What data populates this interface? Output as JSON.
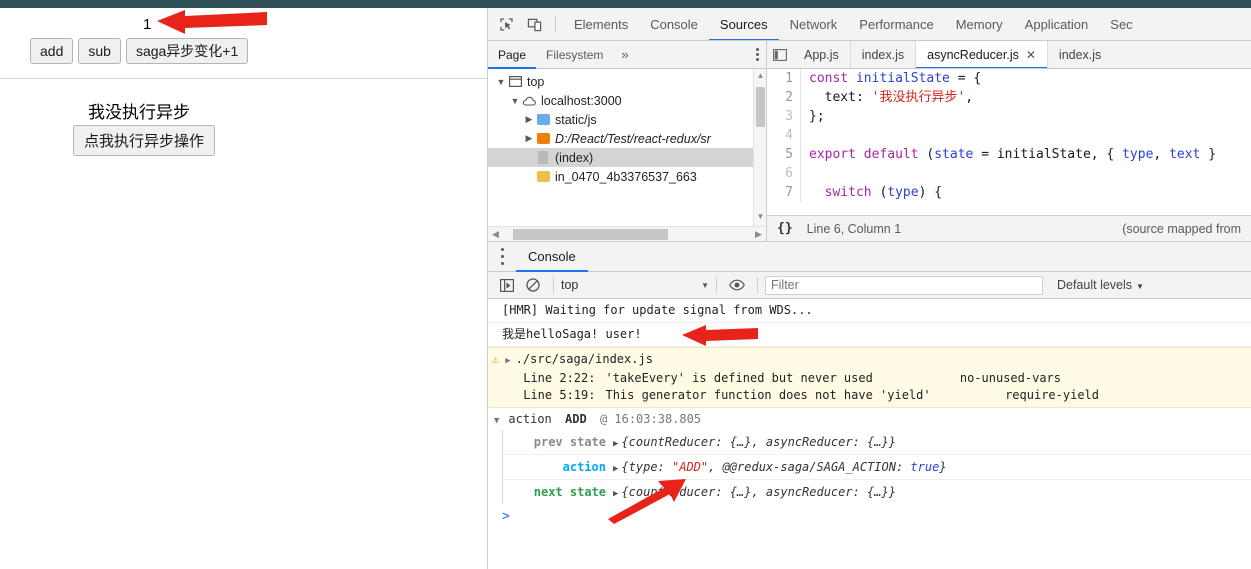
{
  "webpage": {
    "counter_value": "1",
    "buttons": [
      {
        "label": "add",
        "name": "add-button"
      },
      {
        "label": "sub",
        "name": "sub-button"
      },
      {
        "label": "saga异步变化+1",
        "name": "saga-async-button"
      }
    ],
    "async_text": "我没执行异步",
    "async_button": "点我执行异步操作"
  },
  "devtools": {
    "tabs": [
      {
        "label": "Elements",
        "active": false
      },
      {
        "label": "Console",
        "active": false
      },
      {
        "label": "Sources",
        "active": true
      },
      {
        "label": "Network",
        "active": false
      },
      {
        "label": "Performance",
        "active": false
      },
      {
        "label": "Memory",
        "active": false
      },
      {
        "label": "Application",
        "active": false
      },
      {
        "label": "Sec",
        "active": false
      }
    ],
    "inspect_icon": "inspect-element-icon",
    "device_icon": "device-toolbar-icon",
    "navigator": {
      "tabs": [
        {
          "label": "Page",
          "active": true
        },
        {
          "label": "Filesystem",
          "active": false
        }
      ],
      "more_label": "»",
      "tree": [
        {
          "label": "top",
          "indent": 0,
          "twisty": "▼",
          "icon": "frame-icon",
          "selected": false,
          "italic": false
        },
        {
          "label": "localhost:3000",
          "indent": 1,
          "twisty": "▼",
          "icon": "cloud-icon",
          "selected": false,
          "italic": false
        },
        {
          "label": "static/js",
          "indent": 2,
          "twisty": "▶",
          "icon": "folder-blue",
          "selected": false,
          "italic": false
        },
        {
          "label": "D:/React/Test/react-redux/sr",
          "indent": 2,
          "twisty": "▶",
          "icon": "folder-orange",
          "selected": false,
          "italic": true
        },
        {
          "label": "(index)",
          "indent": 3,
          "twisty": "",
          "icon": "file-gray",
          "selected": true,
          "italic": false
        },
        {
          "label": "in_0470_4b3376537_663",
          "indent": 3,
          "twisty": "",
          "icon": "folder-yellow",
          "selected": false,
          "italic": false
        }
      ]
    },
    "editor": {
      "tabs": [
        {
          "label": "App.js",
          "active": false,
          "closable": false
        },
        {
          "label": "index.js",
          "active": false,
          "closable": false
        },
        {
          "label": "asyncReducer.js",
          "active": true,
          "closable": true
        },
        {
          "label": "index.js",
          "active": false,
          "closable": false
        }
      ],
      "close_glyph": "✕",
      "lines": [
        {
          "no": "1",
          "dim": false,
          "tokens": [
            {
              "t": "const ",
              "c": "kw"
            },
            {
              "t": "initialState",
              "c": "var"
            },
            {
              "t": " = {",
              "c": "pl"
            }
          ]
        },
        {
          "no": "2",
          "dim": false,
          "tokens": [
            {
              "t": "  text: ",
              "c": "pl"
            },
            {
              "t": "'我没执行异步'",
              "c": "str"
            },
            {
              "t": ",",
              "c": "pl"
            }
          ]
        },
        {
          "no": "3",
          "dim": true,
          "tokens": [
            {
              "t": "};",
              "c": "pl"
            }
          ]
        },
        {
          "no": "4",
          "dim": true,
          "tokens": [
            {
              "t": "",
              "c": "pl"
            }
          ]
        },
        {
          "no": "5",
          "dim": false,
          "tokens": [
            {
              "t": "export default ",
              "c": "kw"
            },
            {
              "t": "(",
              "c": "pl"
            },
            {
              "t": "state",
              "c": "var"
            },
            {
              "t": " = initialState, { ",
              "c": "pl"
            },
            {
              "t": "type",
              "c": "var"
            },
            {
              "t": ", ",
              "c": "pl"
            },
            {
              "t": "text",
              "c": "var"
            },
            {
              "t": " }",
              "c": "pl"
            }
          ]
        },
        {
          "no": "6",
          "dim": true,
          "tokens": [
            {
              "t": "",
              "c": "pl"
            }
          ]
        },
        {
          "no": "7",
          "dim": false,
          "tokens": [
            {
              "t": "  switch ",
              "c": "kw"
            },
            {
              "t": "(",
              "c": "pl"
            },
            {
              "t": "type",
              "c": "var"
            },
            {
              "t": ") {",
              "c": "pl"
            }
          ]
        }
      ],
      "status": {
        "braces_icon": "pretty-print-icon",
        "position": "Line 6, Column 1",
        "source_mapped": "(source mapped from"
      }
    },
    "drawer": {
      "tab": "Console",
      "toolbar": {
        "sidebar_icon": "console-sidebar-icon",
        "clear_icon": "clear-console-icon",
        "context": "top",
        "eye_icon": "live-expression-icon",
        "filter_placeholder": "Filter",
        "filter_value": "",
        "levels": "Default levels",
        "caret": "▼"
      },
      "messages": [
        {
          "kind": "log",
          "text": "[HMR] Waiting for update signal from WDS..."
        },
        {
          "kind": "log",
          "text": "我是helloSaga! user!"
        },
        {
          "kind": "warning",
          "icon": "warning-icon",
          "title": "./src/saga/index.js",
          "twisty": "▶",
          "lines": [
            {
              "loc": "Line 2:22:",
              "text": "'takeEvery' is defined but never used",
              "rule": "no-unused-vars"
            },
            {
              "loc": "Line 5:19:",
              "text": "This generator function does not have 'yield'",
              "rule": "require-yield"
            }
          ]
        },
        {
          "kind": "group",
          "twisty": "▼",
          "prefix": "action",
          "action_name": "ADD",
          "at": "@ 16:03:38.805",
          "rows": [
            {
              "label": "prev state",
              "style": "prev",
              "twisty": "▶",
              "parts": [
                {
                  "t": "{countReducer: {…}, asyncReducer: {…}}",
                  "c": "plain"
                }
              ]
            },
            {
              "label": "action",
              "style": "action",
              "twisty": "▶",
              "parts": [
                {
                  "t": "{type: ",
                  "c": "plain"
                },
                {
                  "t": "\"ADD\"",
                  "c": "string"
                },
                {
                  "t": ", @@redux-saga/SAGA_ACTION: ",
                  "c": "plain"
                },
                {
                  "t": "true",
                  "c": "bool"
                },
                {
                  "t": "}",
                  "c": "plain"
                }
              ]
            },
            {
              "label": "next state",
              "style": "next",
              "twisty": "▶",
              "parts": [
                {
                  "t": "{countReducer: {…}, asyncReducer: {…}}",
                  "c": "plain"
                }
              ]
            }
          ]
        }
      ],
      "prompt": ">"
    }
  },
  "annotations": {
    "arrow_color": "#e8231a",
    "arrows": [
      {
        "name": "arrow-pointing-to-counter"
      },
      {
        "name": "arrow-pointing-to-hellosaga-log"
      },
      {
        "name": "arrow-pointing-to-action-type"
      }
    ]
  }
}
